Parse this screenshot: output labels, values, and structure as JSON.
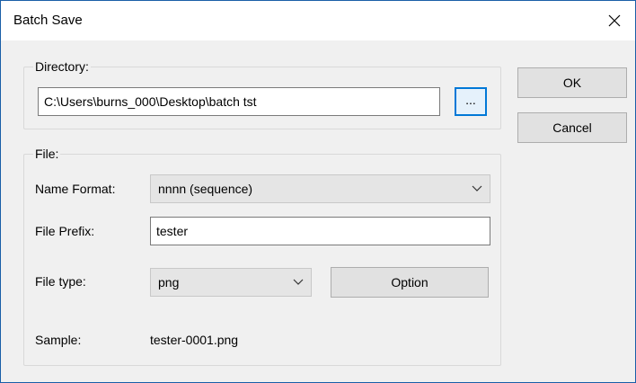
{
  "window": {
    "title": "Batch Save",
    "close_glyph": "✕"
  },
  "directory": {
    "group_label": "Directory:",
    "path_value": "C:\\Users\\burns_000\\Desktop\\batch tst",
    "browse_label": "..."
  },
  "file": {
    "group_label": "File:",
    "name_format_label": "Name Format:",
    "name_format_value": "nnnn (sequence)",
    "prefix_label": "File Prefix:",
    "prefix_value": "tester",
    "type_label": "File type:",
    "type_value": "png",
    "option_label": "Option",
    "sample_label": "Sample:",
    "sample_value": "tester-0001.png"
  },
  "actions": {
    "ok_label": "OK",
    "cancel_label": "Cancel"
  },
  "icons": {
    "close": "close-icon",
    "dropdown": "chevron-down-icon"
  }
}
